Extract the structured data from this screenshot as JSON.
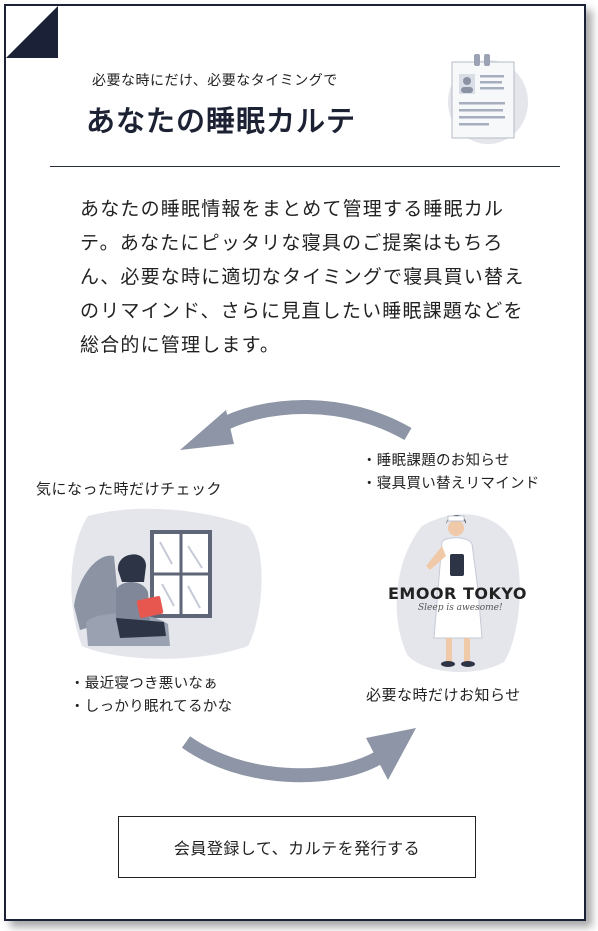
{
  "header": {
    "subtitle": "必要な時にだけ、必要なタイミングで",
    "title": "あなたの睡眠カルテ"
  },
  "description": "あなたの睡眠情報をまとめて管理する睡眠カルテ。あなたにピッタリな寝具のご提案はもちろん、必要な時に適切なタイミングで寝具買い替えのリマインド、さらに見直したい睡眠課題などを総合的に管理します。",
  "flow": {
    "left_label": "気になった時だけチェック",
    "right_items": [
      "・睡眠課題のお知らせ",
      "・寝具買い替えリマインド"
    ],
    "left_items": [
      "・最近寝つき悪いなぁ",
      "・しっかり眠れてるかな"
    ],
    "right_label": "必要な時だけお知らせ",
    "brand": "EMOOR TOKYO",
    "brand_tagline": "Sleep is awesome!"
  },
  "cta": {
    "label": "会員登録して、カルテを発行する"
  },
  "colors": {
    "navy": "#1b2237",
    "arrow": "#8d95a6",
    "illust_bg": "#e4e6ec"
  },
  "icons": [
    "clipboard-icon",
    "reader-illustration",
    "nurse-illustration",
    "curved-arrow-left",
    "curved-arrow-right"
  ]
}
